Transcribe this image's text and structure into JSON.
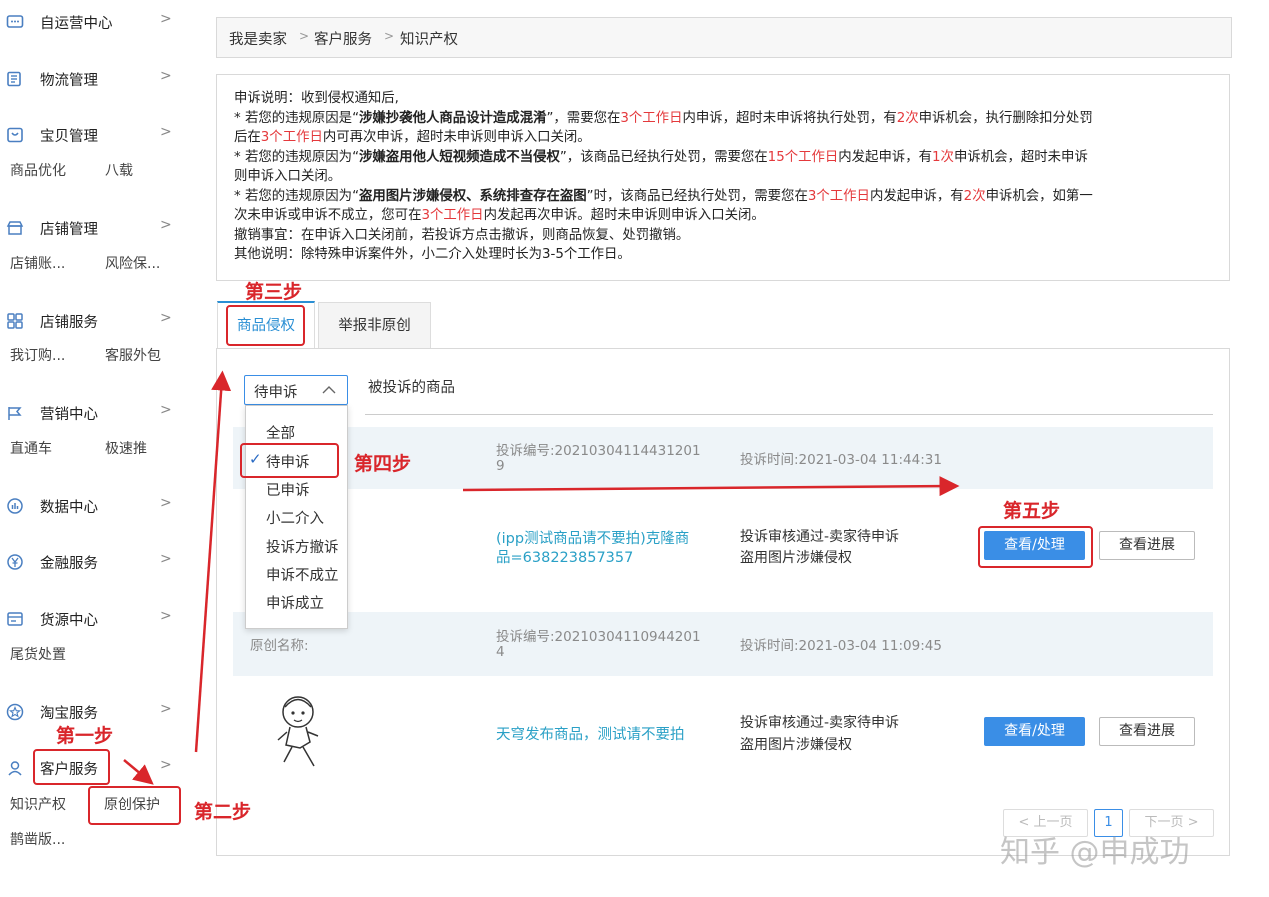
{
  "sidebar": {
    "items": [
      {
        "label": "自运营中心",
        "icon": "chat-icon"
      },
      {
        "label": "物流管理",
        "icon": "logistics-icon"
      },
      {
        "label": "宝贝管理",
        "icon": "product-icon"
      },
      {
        "label": "店铺管理",
        "icon": "shop-icon"
      },
      {
        "label": "店铺服务",
        "icon": "grid-icon"
      },
      {
        "label": "营销中心",
        "icon": "flag-icon"
      },
      {
        "label": "数据中心",
        "icon": "data-icon"
      },
      {
        "label": "金融服务",
        "icon": "yen-icon"
      },
      {
        "label": "货源中心",
        "icon": "supply-icon"
      },
      {
        "label": "淘宝服务",
        "icon": "star-icon"
      },
      {
        "label": "客户服务",
        "icon": "user-icon"
      }
    ],
    "subs": {
      "bao_1": "商品优化",
      "bao_2": "八载",
      "shop_1": "店铺账...",
      "shop_2": "风险保...",
      "svc_1": "我订购...",
      "svc_2": "客服外包",
      "mkt_1": "直通车",
      "mkt_2": "极速推",
      "src_1": "尾货处置",
      "cs_1": "知识产权",
      "cs_2": "原创保护",
      "cs_3": "鹊凿版..."
    }
  },
  "breadcrumb": {
    "a": "我是卖家",
    "sep": ">",
    "b": "客户服务",
    "c": "知识产权"
  },
  "notice": {
    "l1": "申诉说明：收到侵权通知后,",
    "l2_a": "* 若您的违规原因是“",
    "l2_b": "涉嫌抄袭他人商品设计造成混淆",
    "l2_c": "”，需要您在",
    "l2_d": "3个工作日",
    "l2_e": "内申诉，超时未申诉将执行处罚，有",
    "l2_f": "2次",
    "l2_g": "申诉机会，执行删除扣分处罚",
    "l3_a": "后在",
    "l3_b": "3个工作日",
    "l3_c": "内可再次申诉，超时未申诉则申诉入口关闭。",
    "l4_a": "* 若您的违规原因为“",
    "l4_b": "涉嫌盗用他人短视频造成不当侵权",
    "l4_c": "”，该商品已经执行处罚，需要您在",
    "l4_d": "15个工作日",
    "l4_e": "内发起申诉，有",
    "l4_f": "1次",
    "l4_g": "申诉机会，超时未申诉",
    "l5": "则申诉入口关闭。",
    "l6_a": "* 若您的违规原因为“",
    "l6_b": "盗用图片涉嫌侵权、系统排查存在盗图",
    "l6_c": "”时，该商品已经执行处罚，需要您在",
    "l6_d": "3个工作日",
    "l6_e": "内发起申诉，有",
    "l6_f": "2次",
    "l6_g": "申诉机会，如第一",
    "l7_a": "次未申诉或申诉不成立，您可在",
    "l7_b": "3个工作日",
    "l7_c": "内发起再次申诉。超时未申诉则申诉入口关闭。",
    "l8": "撤销事宜：在申诉入口关闭前，若投诉方点击撤诉，则商品恢复、处罚撤销。",
    "l9": "其他说明：除特殊申诉案件外，小二介入处理时长为3-5个工作日。"
  },
  "tabs": {
    "t1": "商品侵权",
    "t2": "举报非原创"
  },
  "filter": {
    "selected": "待申诉",
    "column_label": "被投诉的商品",
    "options": [
      "全部",
      "待申诉",
      "已申诉",
      "小二介入",
      "投诉方撤诉",
      "申诉不成立",
      "申诉成立"
    ]
  },
  "rows": [
    {
      "complaint_no_a": "投诉编号:20210304114431201",
      "complaint_no_b": "9",
      "time": "投诉时间:2021-03-04 11:44:31",
      "product_a": "(ipp测试商品请不要拍)克隆商",
      "product_b": "品=638223857357",
      "status_a": "投诉审核通过-卖家待申诉",
      "status_b": "盗用图片涉嫌侵权",
      "btn_view": "查看/处理",
      "btn_progress": "查看进展"
    },
    {
      "original_name": "原创名称:",
      "complaint_no_a": "投诉编号:20210304110944201",
      "complaint_no_b": "4",
      "time": "投诉时间:2021-03-04 11:09:45",
      "product_a": "天穹发布商品，测试请不要拍",
      "status_a": "投诉审核通过-卖家待申诉",
      "status_b": "盗用图片涉嫌侵权",
      "btn_view": "查看/处理",
      "btn_progress": "查看进展"
    }
  ],
  "pagination": {
    "prev": "< 上一页",
    "page": "1",
    "next": "下一页 >"
  },
  "annotations": {
    "s1": "第一步",
    "s2": "第二步",
    "s3": "第三步",
    "s4": "第四步",
    "s5": "第五步"
  },
  "watermark": "知乎 @申成功",
  "colors": {
    "accent": "#3a8ee6",
    "highlight": "#e4393c",
    "annotation": "#d9262b",
    "link": "#2aa0c6"
  }
}
